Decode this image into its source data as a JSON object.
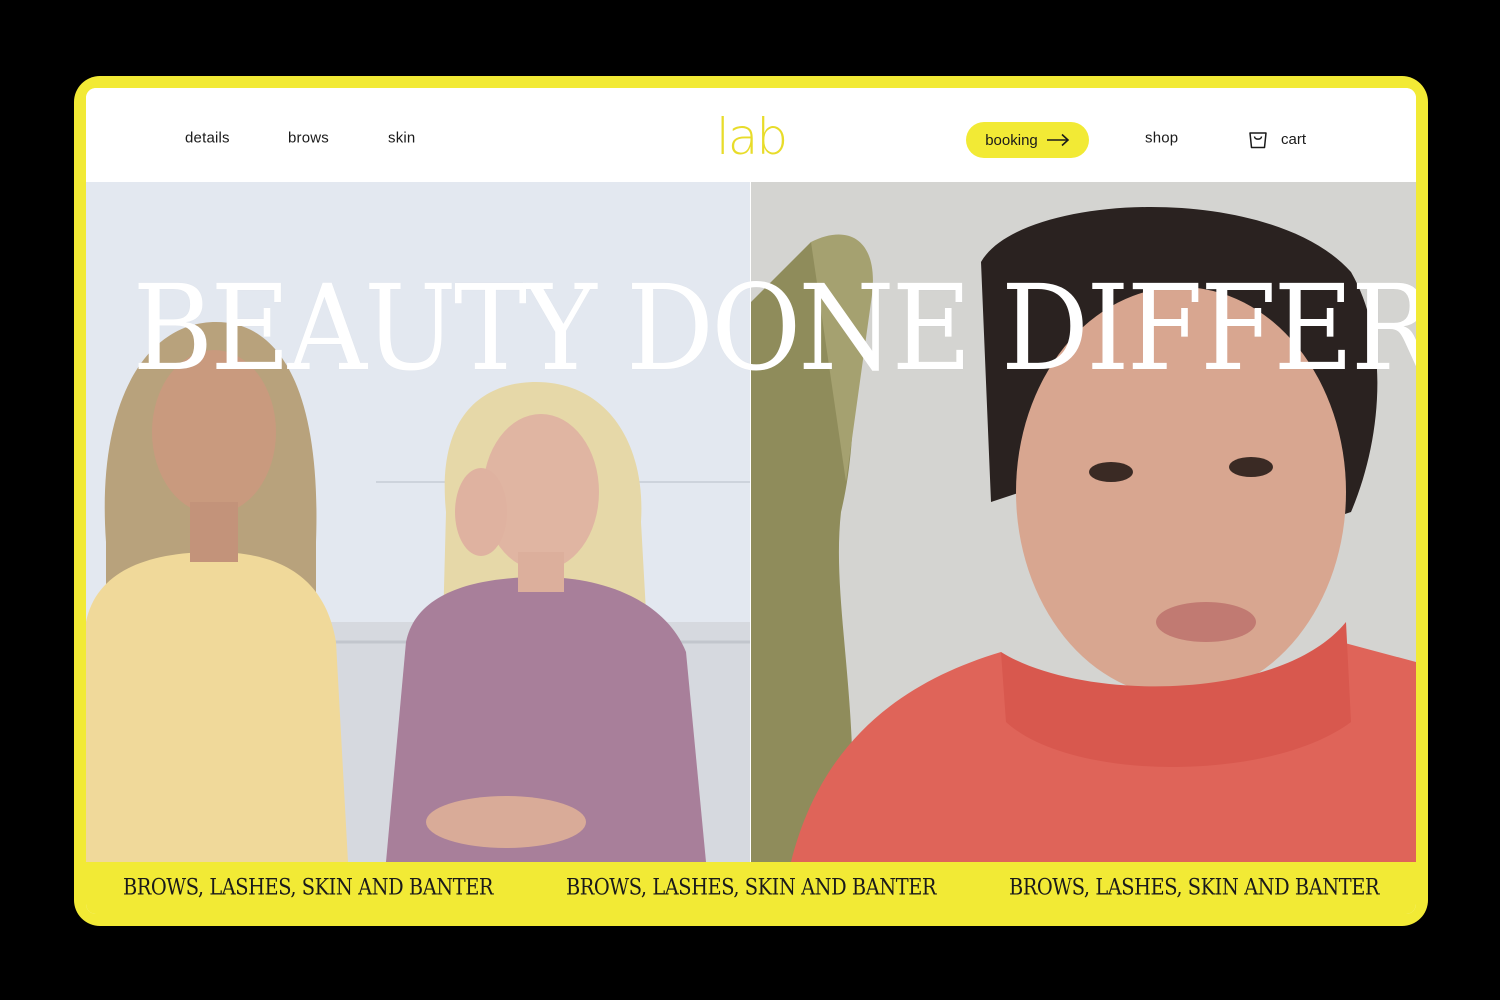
{
  "nav": {
    "left_links": [
      "details",
      "brows",
      "skin"
    ],
    "logo": "lab",
    "booking_label": "booking",
    "shop_label": "shop",
    "cart_label": "cart"
  },
  "hero": {
    "headline": "BEAUTY DONE DIFFERENTLY"
  },
  "ticker": {
    "items": [
      "BROWS, LASHES, SKIN AND BANTER",
      "BROWS, LASHES, SKIN AND BANTER",
      "BROWS, LASHES, SKIN AND BANTER"
    ]
  },
  "colors": {
    "accent_yellow": "#f2ea35",
    "logo_yellow": "#e8dc2a",
    "background": "#000000",
    "text": "#1a1a1a",
    "headline": "#ffffff"
  },
  "icons": {
    "booking": "arrow-right-icon",
    "cart": "shopping-bag-icon"
  }
}
